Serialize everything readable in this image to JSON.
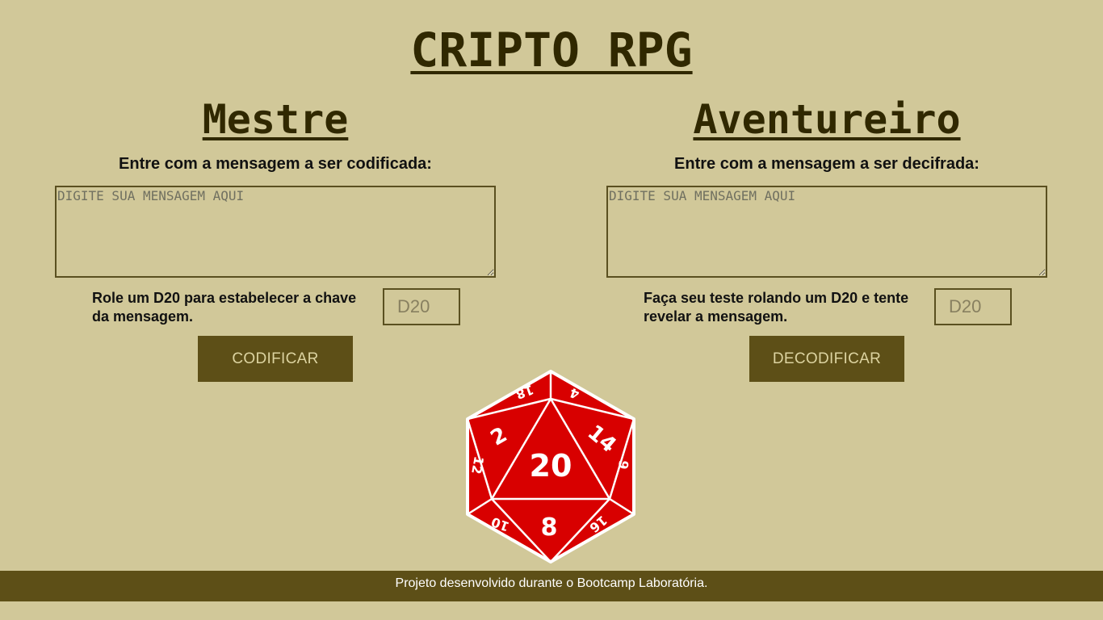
{
  "header": {
    "title": "CRIPTO RPG"
  },
  "master": {
    "heading": "Mestre",
    "prompt": "Entre com a mensagem a ser codificada:",
    "textarea_placeholder": "DIGITE SUA MENSAGEM AQUI",
    "roll_text": "Role um D20 para estabelecer a chave da mensagem.",
    "d20_placeholder": "D20",
    "button_label": "CODIFICAR"
  },
  "adventurer": {
    "heading": "Aventureiro",
    "prompt": "Entre com a mensagem a ser decifrada:",
    "textarea_placeholder": "DIGITE SUA MENSAGEM AQUI",
    "roll_text": "Faça seu teste rolando um D20 e tente revelar a mensagem.",
    "d20_placeholder": "D20",
    "button_label": "DECODIFICAR"
  },
  "dice": {
    "icon": "d20-dice-icon",
    "faces": [
      "20",
      "2",
      "14",
      "8",
      "18",
      "4",
      "12",
      "6",
      "10",
      "16"
    ],
    "color": "#d80000"
  },
  "footer": {
    "text": "Projeto desenvolvido durante o Bootcamp Laboratória."
  },
  "colors": {
    "background": "#d1c899",
    "accent": "#5d4f17",
    "title": "#302800"
  }
}
